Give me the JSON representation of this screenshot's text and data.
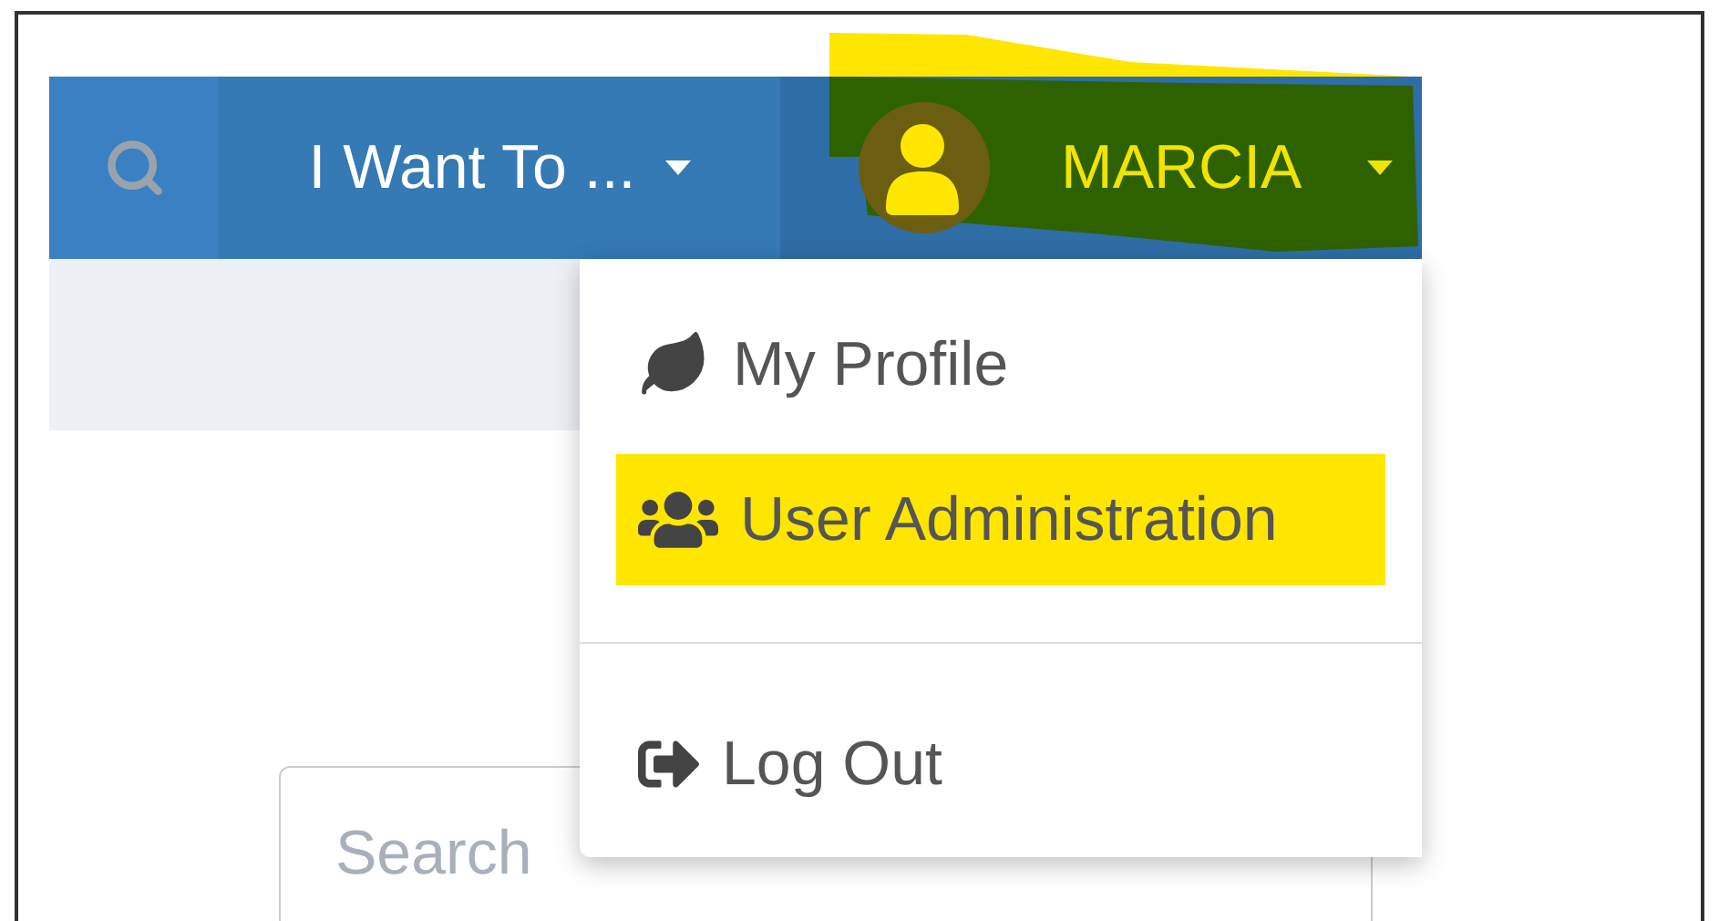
{
  "navbar": {
    "menu": {
      "label": "I Want To ..."
    },
    "user": {
      "name": "MARCIA",
      "highlighted": true
    }
  },
  "user_menu": {
    "items": [
      {
        "label": "My Profile",
        "kind": "profile",
        "highlighted": false
      },
      {
        "label": "User Administration",
        "kind": "users",
        "highlighted": true
      },
      {
        "kind": "divider"
      },
      {
        "label": "Log Out",
        "kind": "logout",
        "highlighted": false
      }
    ]
  },
  "search": {
    "placeholder": "Search"
  }
}
